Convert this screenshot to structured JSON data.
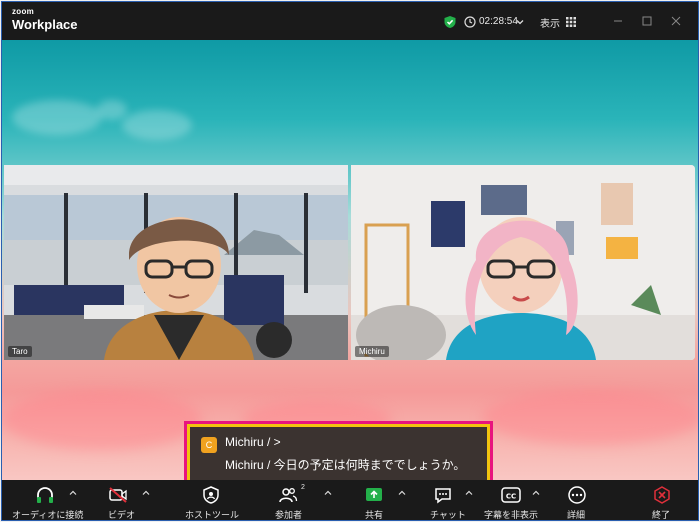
{
  "app": {
    "brand_small": "zoom",
    "brand_big": "Workplace"
  },
  "titlebar": {
    "timer": "02:28:54",
    "view_label": "表示"
  },
  "participants": [
    {
      "name": "Taro"
    },
    {
      "name": "Michiru"
    }
  ],
  "caption": {
    "avatar_letter": "C",
    "line1": "Michiru / >",
    "line2": "Michiru / 今日の予定は何時まででしょうか。"
  },
  "toolbar": {
    "audio": "オーディオに接続",
    "video": "ビデオ",
    "host_tools": "ホストツール",
    "participants": "参加者",
    "participants_count": "2",
    "share": "共有",
    "chat": "チャット",
    "captions": "字幕を非表示",
    "more": "詳細",
    "end": "終了"
  },
  "colors": {
    "accent_green": "#23b04a",
    "end_red": "#e0303b",
    "caption_border_outer": "#e8147e",
    "caption_border_inner": "#f1c40f"
  }
}
